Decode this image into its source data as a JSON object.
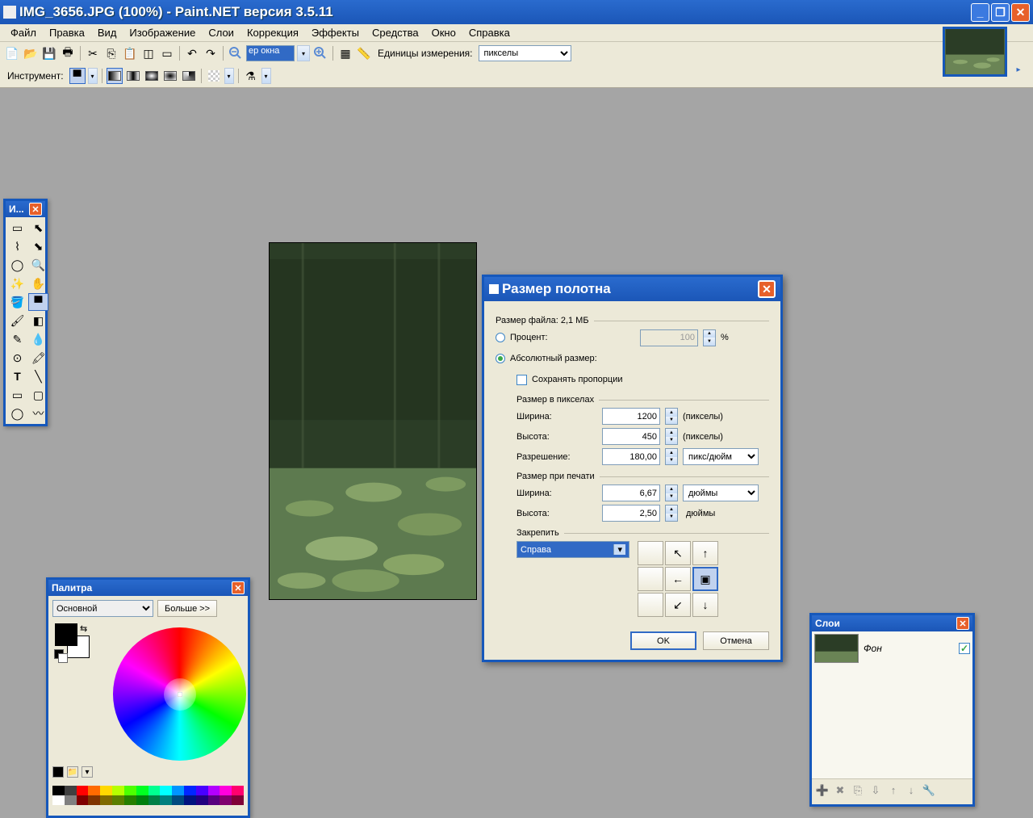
{
  "title": "IMG_3656.JPG (100%) - Paint.NET версия 3.5.11",
  "menu": [
    "Файл",
    "Правка",
    "Вид",
    "Изображение",
    "Слои",
    "Коррекция",
    "Эффекты",
    "Средства",
    "Окно",
    "Справка"
  ],
  "toolbar": {
    "zoom_value": "ер окна",
    "units_label": "Единицы измерения:",
    "units_value": "пикселы",
    "instrument_label": "Инструмент:"
  },
  "tools_panel": {
    "title": "И..."
  },
  "colors_panel": {
    "title": "Палитра",
    "primary_label": "Основной",
    "more_label": "Больше >>",
    "palette_colors": [
      "#000000",
      "#404040",
      "#ff0000",
      "#ff6a00",
      "#ffd800",
      "#b6ff00",
      "#4cff00",
      "#00ff21",
      "#00ff90",
      "#00ffff",
      "#0094ff",
      "#0026ff",
      "#4800ff",
      "#b200ff",
      "#ff00dc",
      "#ff006e",
      "#ffffff",
      "#808080",
      "#7f0000",
      "#7f3300",
      "#7f6a00",
      "#5b7f00",
      "#267f00",
      "#007f0e",
      "#007f46",
      "#007f7f",
      "#004a7f",
      "#00137f",
      "#21007f",
      "#57007f",
      "#7f006e",
      "#7f0037"
    ]
  },
  "dialog": {
    "title": "Размер полотна",
    "filesize_label": "Размер файла: 2,1 МБ",
    "percent_label": "Процент:",
    "percent_value": "100",
    "percent_unit": "%",
    "absolute_label": "Абсолютный размер:",
    "keep_ratio_label": "Сохранять пропорции",
    "px_group": "Размер в пикселах",
    "width_label": "Ширина:",
    "height_label": "Высота:",
    "res_label": "Разрешение:",
    "width_px": "1200",
    "height_px": "450",
    "px_unit": "(пикселы)",
    "res_value": "180,00",
    "res_unit": "пикс/дюйм",
    "print_group": "Размер при печати",
    "width_print": "6,67",
    "height_print": "2,50",
    "print_unit": "дюймы",
    "anchor_label": "Закрепить",
    "anchor_value": "Справа",
    "ok": "OK",
    "cancel": "Отмена"
  },
  "layers_panel": {
    "title": "Слои",
    "layer0": "Фон"
  }
}
